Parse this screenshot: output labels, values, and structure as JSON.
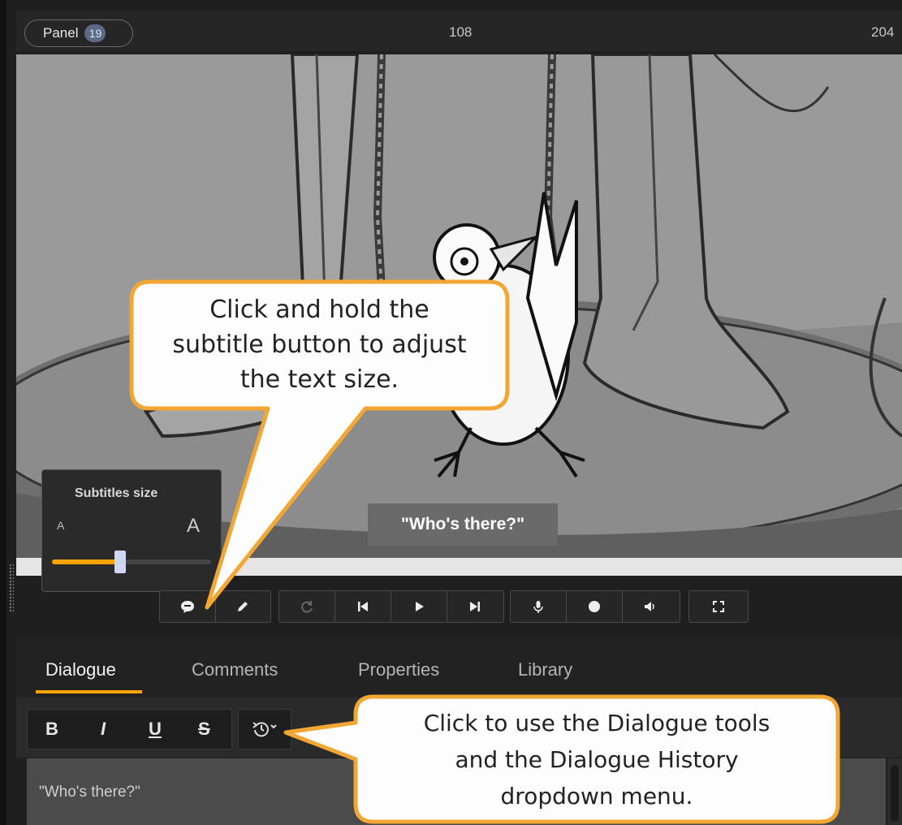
{
  "ruler": {
    "panel_label": "Panel",
    "panel_count": "19",
    "frame_mid": "108",
    "frame_end": "204"
  },
  "canvas": {
    "caption": "\"Who's there?\""
  },
  "subtitles_popup": {
    "title": "Subtitles size",
    "small_label": "A",
    "large_label": "A",
    "level": 0.43
  },
  "playback_toolbar": [
    {
      "icon": "subtitle-icon"
    },
    {
      "icon": "pencil-icon"
    },
    {
      "icon": "loop-icon"
    },
    {
      "icon": "skip-previous-icon"
    },
    {
      "icon": "play-icon"
    },
    {
      "icon": "skip-next-icon"
    },
    {
      "icon": "microphone-icon"
    },
    {
      "icon": "record-icon"
    },
    {
      "icon": "volume-icon"
    },
    {
      "icon": "fullscreen-icon"
    }
  ],
  "tabs": [
    "Dialogue",
    "Comments",
    "Properties",
    "Library"
  ],
  "active_tab": "Dialogue",
  "format_toolbar": {
    "bold": "B",
    "italic": "I",
    "underline": "U",
    "strikethrough": "S",
    "history_icon": "history-icon"
  },
  "dialogue": {
    "text": "\"Who's there?\""
  },
  "callouts": {
    "subtitle": [
      "Click and hold the",
      "subtitle button to adjust",
      "the text size."
    ],
    "dialogue_tools": [
      "Click to use the Dialogue tools",
      "and the Dialogue History",
      "dropdown menu."
    ]
  },
  "colors": {
    "accent": "#f7a300",
    "callout_fill": "#fdfdfd",
    "callout_border": "#f2a633"
  }
}
